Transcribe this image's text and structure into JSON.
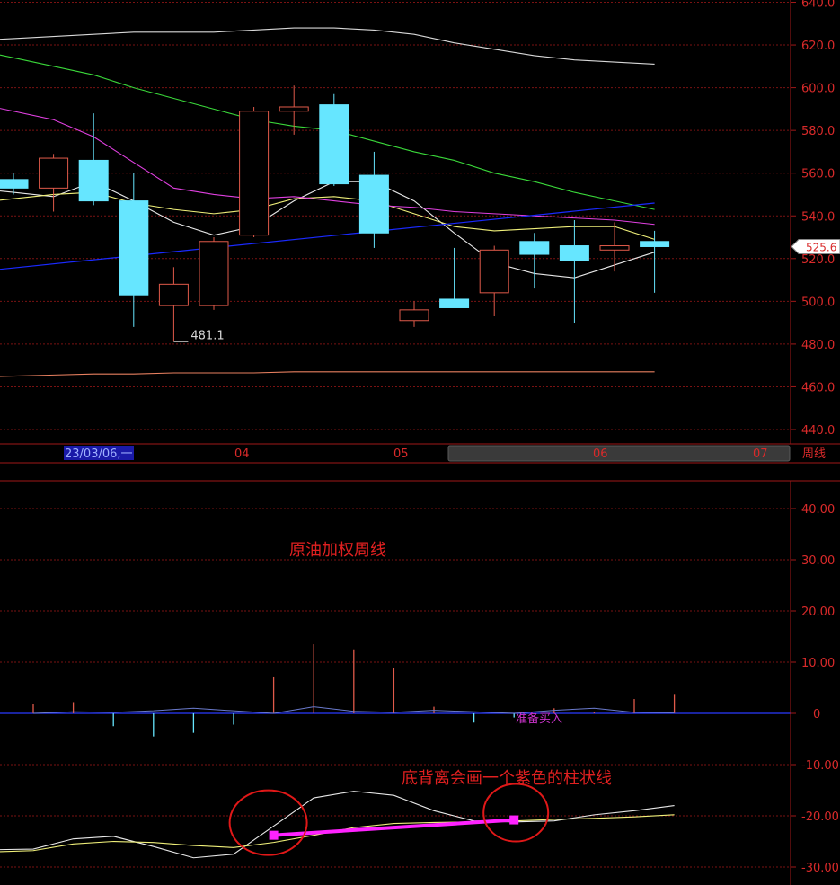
{
  "colors": {
    "background": "#000000",
    "grid": "#7a1212",
    "axis": "#a01818",
    "up_candle": "#e05a4a",
    "down_candle": "#66e6ff",
    "ma_white": "#e8e8e8",
    "ma_yellow": "#f0f07a",
    "ma_magenta": "#e040e0",
    "ma_green": "#3ad83a",
    "ma_gray": "#d8d8d8",
    "ma_orange": "#e88060",
    "trend_blue": "#1a2aff",
    "zero_line": "#2a3aff",
    "signal_line": "#ff22ff",
    "circle": "#e01818",
    "label_red": "#d92a2a"
  },
  "chart_data": [
    {
      "type": "candlestick",
      "period": "周线",
      "ylim": [
        440,
        640
      ],
      "yticks": [
        "640.0",
        "620.0",
        "600.0",
        "580.0",
        "560.0",
        "540.0",
        "520.0",
        "500.0",
        "480.0",
        "460.0",
        "440.0"
      ],
      "last_price": "525.6",
      "low_marker": "481.1",
      "date_axis": {
        "selected_date": "23/03/06,一",
        "months": [
          "04",
          "05",
          "06",
          "07"
        ],
        "period_label": "周线"
      },
      "candles": [
        {
          "open": 557,
          "close": 553,
          "high": 560,
          "low": 550
        },
        {
          "open": 553,
          "close": 567,
          "high": 569,
          "low": 542
        },
        {
          "open": 566,
          "close": 547,
          "high": 588,
          "low": 545
        },
        {
          "open": 547,
          "close": 503,
          "high": 560,
          "low": 488
        },
        {
          "open": 498,
          "close": 508,
          "high": 516,
          "low": 481.1
        },
        {
          "open": 498,
          "close": 528,
          "high": 530,
          "low": 496
        },
        {
          "open": 531,
          "close": 589,
          "high": 591,
          "low": 530
        },
        {
          "open": 589,
          "close": 591,
          "high": 601,
          "low": 578
        },
        {
          "open": 592,
          "close": 555,
          "high": 597,
          "low": 554
        },
        {
          "open": 559,
          "close": 532,
          "high": 570,
          "low": 525
        },
        {
          "open": 491,
          "close": 496,
          "high": 500,
          "low": 488
        },
        {
          "open": 501,
          "close": 497,
          "high": 525,
          "low": 497
        },
        {
          "open": 504,
          "close": 524,
          "high": 526,
          "low": 493
        },
        {
          "open": 528,
          "close": 522,
          "high": 532,
          "low": 506
        },
        {
          "open": 526,
          "close": 519,
          "high": 538,
          "low": 490
        },
        {
          "open": 524,
          "close": 526,
          "high": 537,
          "low": 514
        },
        {
          "open": 528,
          "close": 525.6,
          "high": 533,
          "low": 504
        }
      ],
      "moving_averages": [
        {
          "color_key": "ma_white",
          "values": [
            551,
            549,
            556,
            547,
            537,
            531,
            535,
            547,
            556,
            556,
            547,
            532,
            518,
            513,
            511,
            517,
            523
          ]
        },
        {
          "color_key": "ma_yellow",
          "values": [
            548,
            550,
            551,
            546,
            543,
            541,
            543,
            548,
            549,
            547,
            541,
            535,
            533,
            534,
            535,
            535,
            529
          ]
        },
        {
          "color_key": "ma_magenta",
          "values": [
            589,
            585,
            577,
            565,
            553,
            550,
            548,
            549,
            547,
            545,
            544,
            542,
            541,
            540,
            539,
            538,
            536
          ]
        },
        {
          "color_key": "ma_green",
          "values": [
            614,
            610,
            606,
            600,
            595,
            590,
            585,
            582,
            580,
            575,
            570,
            566,
            560,
            556,
            551,
            547,
            543
          ]
        },
        {
          "color_key": "ma_gray",
          "values": [
            623,
            624,
            625,
            626,
            626,
            626,
            627,
            628,
            628,
            627,
            625,
            621,
            618,
            615,
            613,
            612,
            611
          ]
        },
        {
          "color_key": "ma_orange",
          "values": [
            465,
            465.5,
            466,
            466,
            466.5,
            466.5,
            466.5,
            467,
            467,
            467,
            467,
            467,
            467,
            467,
            467,
            467,
            467
          ]
        }
      ],
      "trendline": {
        "color_key": "trend_blue",
        "start": 518,
        "end": 546
      }
    },
    {
      "type": "oscillator",
      "ylim": [
        -32,
        45
      ],
      "yticks": [
        "40.00",
        "30.00",
        "20.00",
        "10.00",
        "0",
        "-10.00",
        "-20.00",
        "-30.00"
      ],
      "histogram": [
        1.8,
        2.2,
        -2.5,
        -4.5,
        -3.8,
        -2.2,
        7.2,
        13.5,
        12.5,
        8.8,
        1.3,
        -1.8,
        -0.8,
        1.0,
        0.2,
        2.8,
        3.8
      ],
      "fast_line": [
        -26.5,
        -24.5,
        -24.0,
        -26.0,
        -28.2,
        -27.5,
        -22.0,
        -16.5,
        -15.2,
        -16.0,
        -19.0,
        -21.0,
        -21.2,
        -21.0,
        -19.8,
        -19.0,
        -18.0
      ],
      "slow_line": [
        -26.8,
        -25.5,
        -25.0,
        -25.2,
        -25.8,
        -26.2,
        -25.2,
        -23.8,
        -22.3,
        -21.5,
        -21.3,
        -21.2,
        -21.0,
        -20.7,
        -20.5,
        -20.2,
        -19.8
      ],
      "histogram_lines": [
        0,
        0.3,
        0.2,
        0.5,
        1.0,
        0.5,
        0,
        1.3,
        0.4,
        0.2,
        0.6,
        0.3,
        0,
        0.6,
        1.0,
        0.2,
        0.1
      ],
      "signal_segment": {
        "from_index": 6,
        "to_index": 12,
        "from_value": -23.8,
        "to_value": -20.8
      },
      "signal_text": "准备买入",
      "title_note": "原油加权周线",
      "divergence_note": "底背离会画一个紫色的柱状线"
    }
  ]
}
